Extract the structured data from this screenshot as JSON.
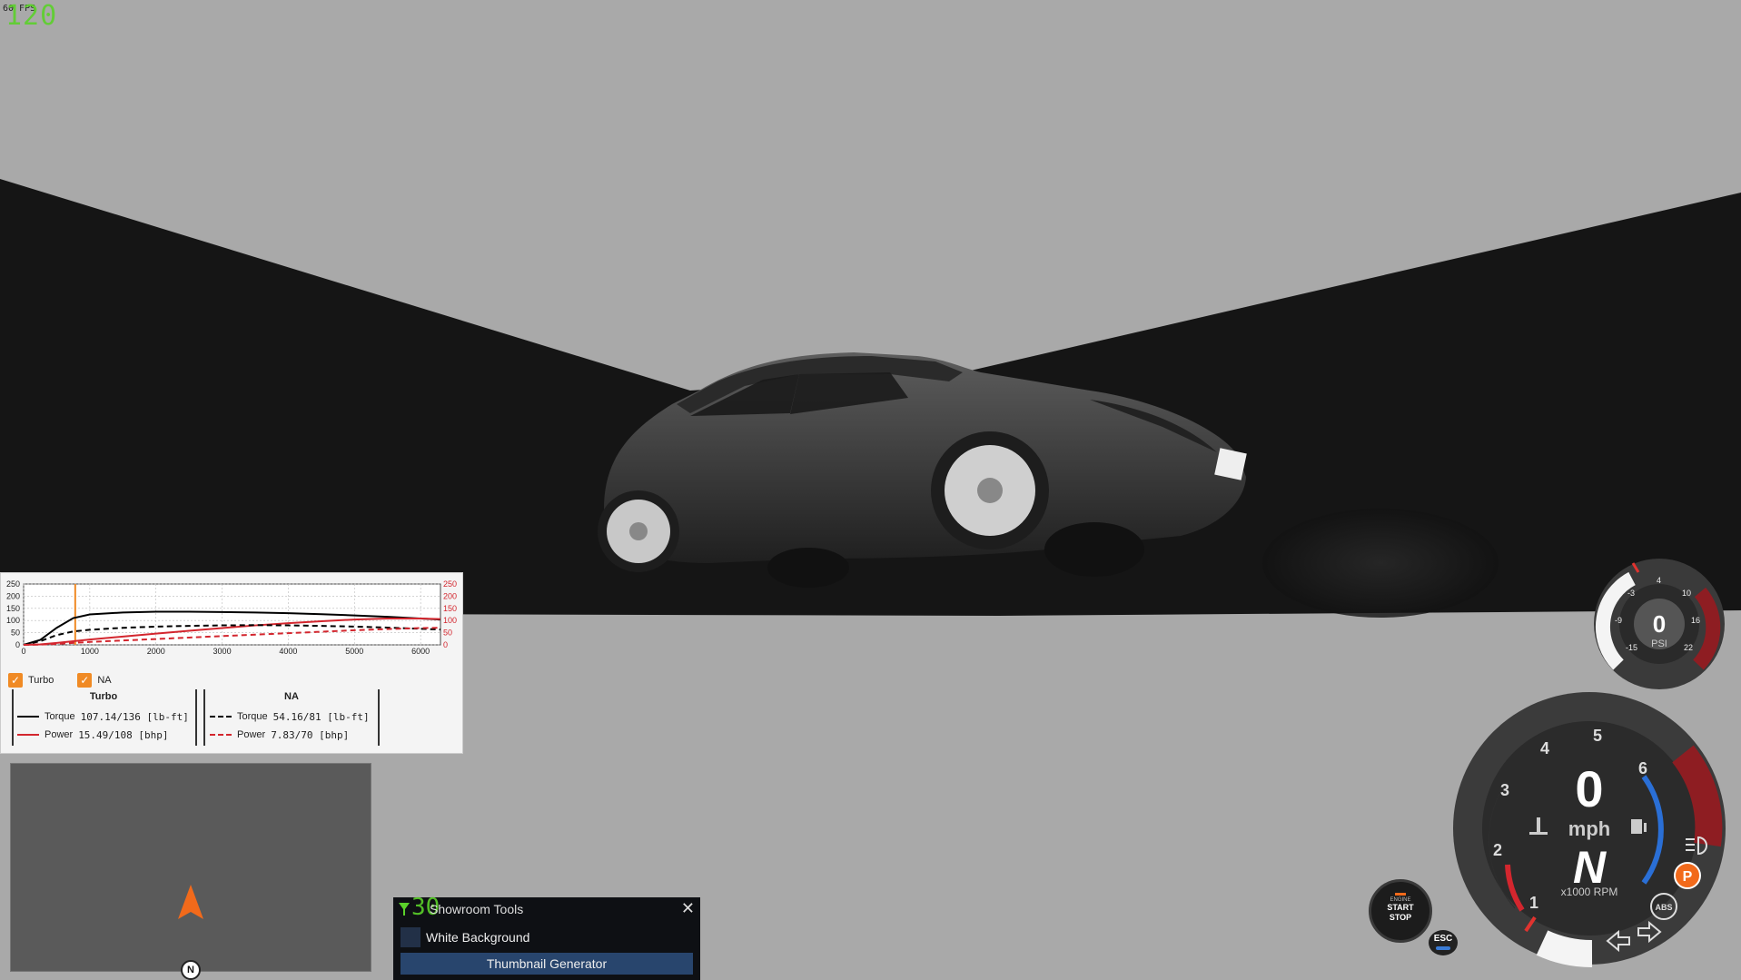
{
  "hud": {
    "fps_small": "60 FPS",
    "fps_big": "120"
  },
  "torque_curve": {
    "legend": {
      "turbo": "Turbo",
      "na": "NA"
    },
    "turbo": {
      "header": "Turbo",
      "torque_label": "Torque",
      "torque_value": "107.14/136 [lb-ft]",
      "power_label": "Power",
      "power_value": "15.49/108  [bhp]"
    },
    "na": {
      "header": "NA",
      "torque_label": "Torque",
      "torque_value": "54.16/81 [lb-ft]",
      "power_label": "Power",
      "power_value": "7.83/70  [bhp]"
    }
  },
  "chart_data": {
    "type": "line",
    "x": [
      0,
      250,
      500,
      750,
      1000,
      1500,
      2000,
      2500,
      3000,
      3500,
      4000,
      4500,
      5000,
      5500,
      6000,
      6300
    ],
    "xticks": [
      "0",
      "1000",
      "2000",
      "3000",
      "4000",
      "5000",
      "6000"
    ],
    "xlim": [
      0,
      6300
    ],
    "yticks_left": [
      "0",
      "50",
      "100",
      "150",
      "200",
      "250"
    ],
    "yticks_right": [
      "0",
      "50",
      "100",
      "150",
      "200",
      "250"
    ],
    "ylim": [
      0,
      250
    ],
    "cursor_rpm": 780,
    "grid": true,
    "series": [
      {
        "color": "#000000",
        "dash": false,
        "values": [
          0,
          20,
          70,
          110,
          125,
          133,
          136,
          136,
          135,
          133,
          130,
          126,
          121,
          115,
          108,
          104
        ]
      },
      {
        "color": "#d3262e",
        "dash": false,
        "values": [
          0,
          2,
          8,
          15,
          22,
          34,
          46,
          58,
          69,
          80,
          89,
          97,
          104,
          108,
          108,
          106
        ]
      },
      {
        "color": "#000000",
        "dash": true,
        "values": [
          0,
          15,
          40,
          55,
          62,
          70,
          75,
          78,
          80,
          81,
          80,
          78,
          75,
          71,
          66,
          63
        ]
      },
      {
        "color": "#d3262e",
        "dash": true,
        "values": [
          0,
          1,
          4,
          8,
          12,
          18,
          24,
          30,
          36,
          42,
          48,
          54,
          60,
          65,
          69,
          70
        ]
      }
    ]
  },
  "showroom_tools": {
    "fps": "30",
    "title": "Showroom Tools",
    "close": "✕",
    "white_background": "White Background",
    "thumbnail_generator": "Thumbnail Generator"
  },
  "minimap": {
    "north": "N"
  },
  "boost_gauge": {
    "value": "0",
    "unit": "PSI",
    "ticks": [
      "-15",
      "-9",
      "-3",
      "4",
      "10",
      "16",
      "22"
    ]
  },
  "speedo": {
    "speed": "0",
    "unit": "mph",
    "gear": "N",
    "rpm_unit": "x1000 RPM",
    "rpm_ticks": [
      "1",
      "2",
      "3",
      "4",
      "5",
      "6"
    ],
    "park": "P",
    "abs": "ABS"
  },
  "engine_button": {
    "small": "ENGINE",
    "line1": "START",
    "line2": "STOP"
  },
  "esc": "ESC",
  "colors": {
    "accent_orange": "#f26a1b",
    "fps_green": "#5bd12a",
    "redline": "#b0232a",
    "blue_fuel": "#2a6fd6"
  }
}
